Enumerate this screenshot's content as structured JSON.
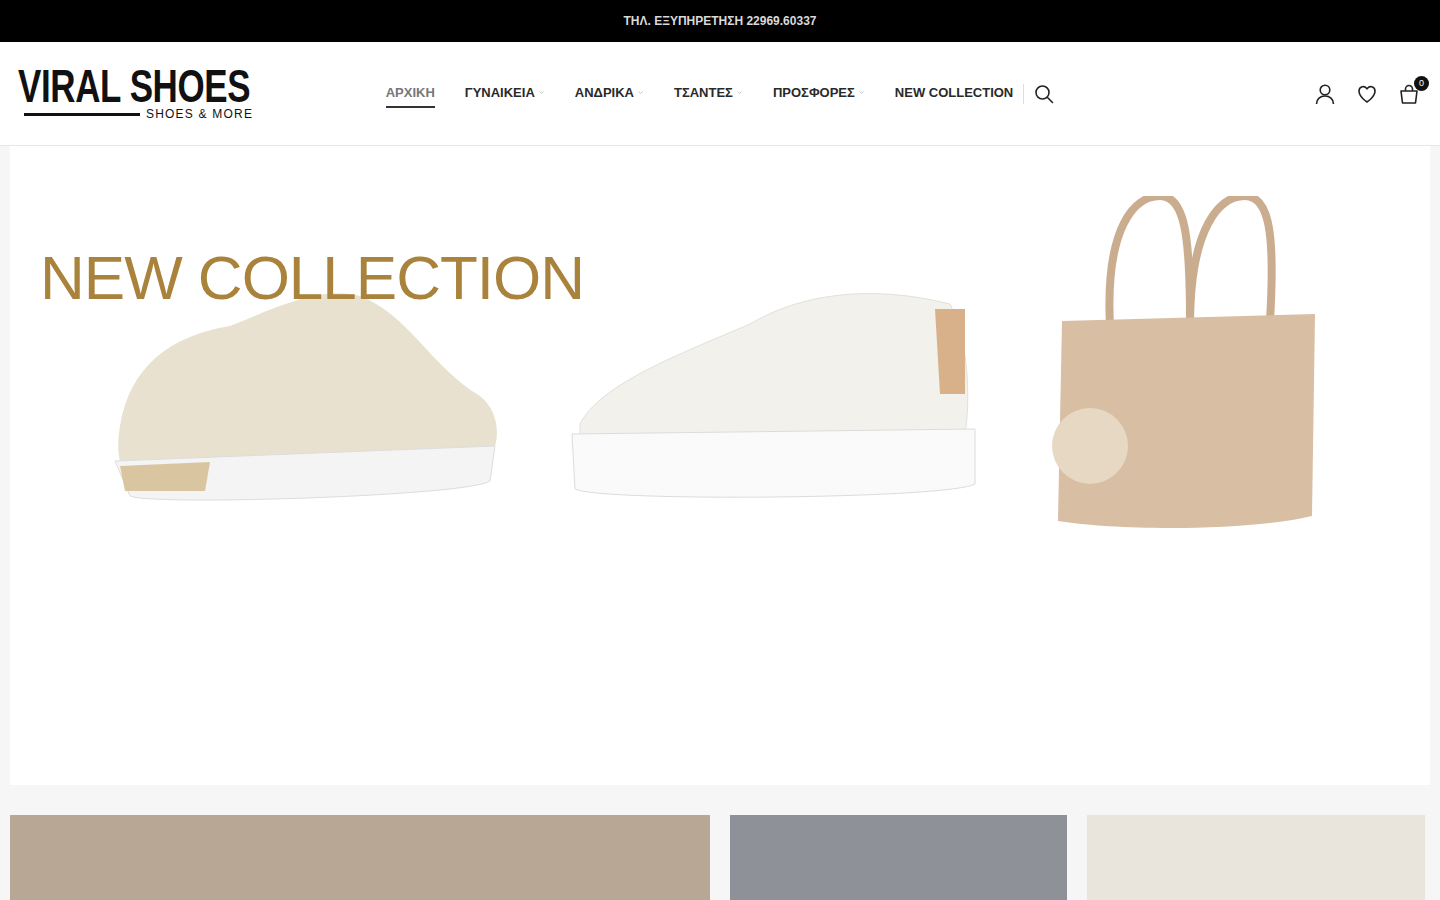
{
  "top_bar": {
    "text": "ΤΗΛ. ΕΞΥΠΗΡΕΤΗΣΗ 22969.60337"
  },
  "logo": {
    "title": "VIRAL SHOES",
    "subtitle": "SHOES & MORE"
  },
  "nav": [
    {
      "label": "ΑΡΧΙΚΗ",
      "selected": true,
      "kind": "link"
    },
    {
      "label": "ΓΥΝΑΙΚΕΙΑ",
      "selected": false,
      "kind": "dropdown"
    },
    {
      "label": "ΑΝΔΡΙΚΑ",
      "selected": false,
      "kind": "dropdown"
    },
    {
      "label": "ΤΣΑΝΤΕΣ",
      "selected": false,
      "kind": "dropdown"
    },
    {
      "label": "ΠΡΟΣΦΟΡΕΣ",
      "selected": false,
      "kind": "dropdown"
    },
    {
      "label": "NEW COLLECTION",
      "selected": false,
      "kind": "link"
    }
  ],
  "cart": {
    "count": "0"
  },
  "hero": {
    "title": "NEW COLLECTION"
  }
}
